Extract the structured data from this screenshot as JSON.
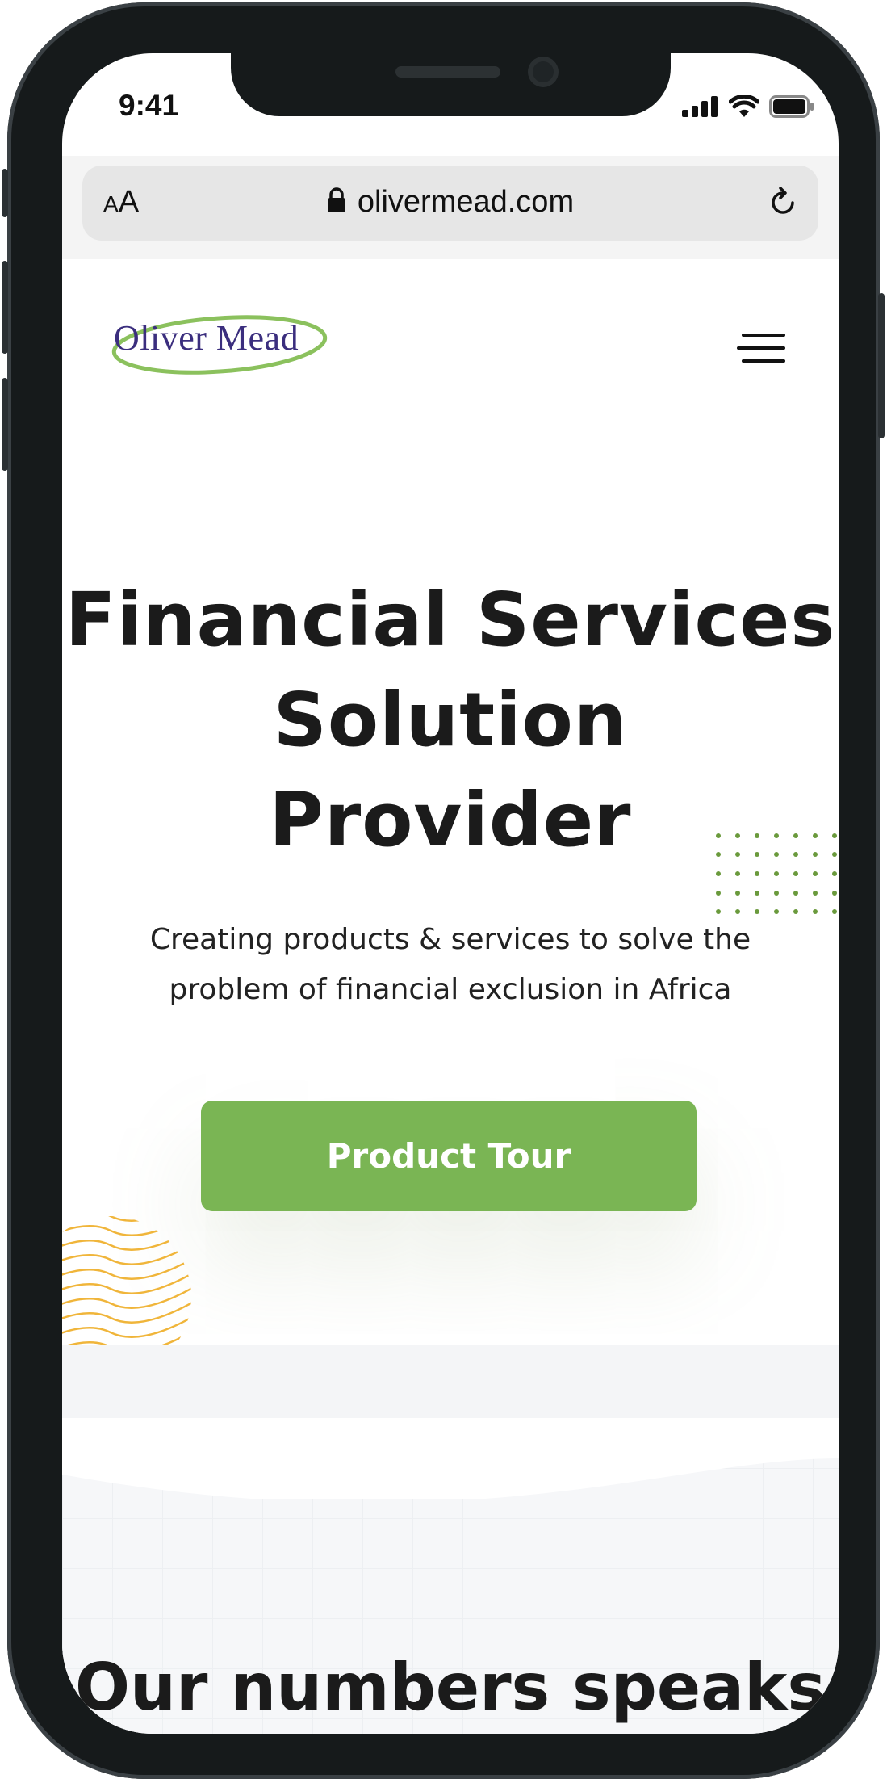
{
  "status_bar": {
    "time": "9:41"
  },
  "browser": {
    "text_size_small": "A",
    "text_size_large": "A",
    "url": "olivermead.com"
  },
  "site": {
    "logo_text": "Oliver Mead"
  },
  "hero": {
    "title_line1": "Financial Services",
    "title_line2": "Solution",
    "title_line3": "Provider",
    "subtitle_line1": "Creating products & services to solve the",
    "subtitle_line2": "problem of financial exclusion in Africa",
    "cta_label": "Product Tour"
  },
  "numbers_section": {
    "title": "Our numbers speaks"
  },
  "colors": {
    "accent": "#7ab554",
    "logo_purple": "#3b2e7e",
    "logo_ring": "#8bc15d",
    "swirl": "#f0b53a",
    "text": "#1b1b1b"
  }
}
